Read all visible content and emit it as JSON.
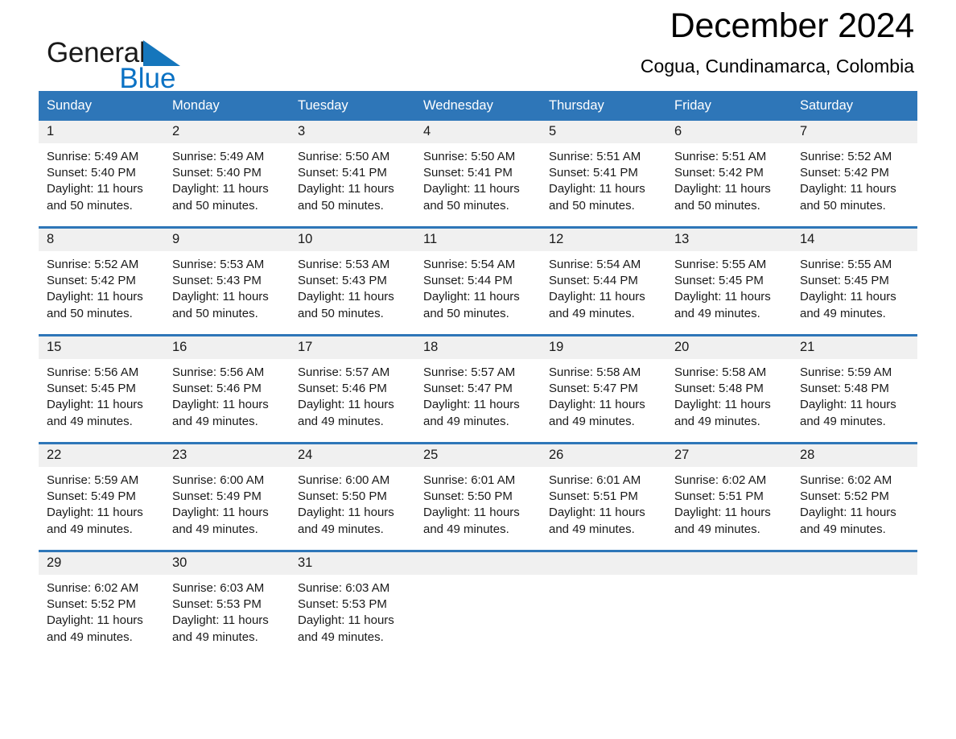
{
  "brand": {
    "name_part1": "General",
    "name_part2": "Blue",
    "triangle_color": "#1576bc",
    "logo_icon": "general-blue-triangle-logo"
  },
  "header": {
    "title": "December 2024",
    "subtitle": "Cogua, Cundinamarca, Colombia"
  },
  "theme": {
    "header_blue": "#2e76b8",
    "row_divider_blue": "#2e76b8",
    "daynum_band": "#f0f0f0",
    "text": "#1a1a1a",
    "page_background": "#ffffff"
  },
  "weekday_headers": [
    "Sunday",
    "Monday",
    "Tuesday",
    "Wednesday",
    "Thursday",
    "Friday",
    "Saturday"
  ],
  "weeks": [
    {
      "days": [
        {
          "date": "1",
          "sunrise": "Sunrise: 5:49 AM",
          "sunset": "Sunset: 5:40 PM",
          "daylight_line1": "Daylight: 11 hours",
          "daylight_line2": "and 50 minutes."
        },
        {
          "date": "2",
          "sunrise": "Sunrise: 5:49 AM",
          "sunset": "Sunset: 5:40 PM",
          "daylight_line1": "Daylight: 11 hours",
          "daylight_line2": "and 50 minutes."
        },
        {
          "date": "3",
          "sunrise": "Sunrise: 5:50 AM",
          "sunset": "Sunset: 5:41 PM",
          "daylight_line1": "Daylight: 11 hours",
          "daylight_line2": "and 50 minutes."
        },
        {
          "date": "4",
          "sunrise": "Sunrise: 5:50 AM",
          "sunset": "Sunset: 5:41 PM",
          "daylight_line1": "Daylight: 11 hours",
          "daylight_line2": "and 50 minutes."
        },
        {
          "date": "5",
          "sunrise": "Sunrise: 5:51 AM",
          "sunset": "Sunset: 5:41 PM",
          "daylight_line1": "Daylight: 11 hours",
          "daylight_line2": "and 50 minutes."
        },
        {
          "date": "6",
          "sunrise": "Sunrise: 5:51 AM",
          "sunset": "Sunset: 5:42 PM",
          "daylight_line1": "Daylight: 11 hours",
          "daylight_line2": "and 50 minutes."
        },
        {
          "date": "7",
          "sunrise": "Sunrise: 5:52 AM",
          "sunset": "Sunset: 5:42 PM",
          "daylight_line1": "Daylight: 11 hours",
          "daylight_line2": "and 50 minutes."
        }
      ]
    },
    {
      "days": [
        {
          "date": "8",
          "sunrise": "Sunrise: 5:52 AM",
          "sunset": "Sunset: 5:42 PM",
          "daylight_line1": "Daylight: 11 hours",
          "daylight_line2": "and 50 minutes."
        },
        {
          "date": "9",
          "sunrise": "Sunrise: 5:53 AM",
          "sunset": "Sunset: 5:43 PM",
          "daylight_line1": "Daylight: 11 hours",
          "daylight_line2": "and 50 minutes."
        },
        {
          "date": "10",
          "sunrise": "Sunrise: 5:53 AM",
          "sunset": "Sunset: 5:43 PM",
          "daylight_line1": "Daylight: 11 hours",
          "daylight_line2": "and 50 minutes."
        },
        {
          "date": "11",
          "sunrise": "Sunrise: 5:54 AM",
          "sunset": "Sunset: 5:44 PM",
          "daylight_line1": "Daylight: 11 hours",
          "daylight_line2": "and 50 minutes."
        },
        {
          "date": "12",
          "sunrise": "Sunrise: 5:54 AM",
          "sunset": "Sunset: 5:44 PM",
          "daylight_line1": "Daylight: 11 hours",
          "daylight_line2": "and 49 minutes."
        },
        {
          "date": "13",
          "sunrise": "Sunrise: 5:55 AM",
          "sunset": "Sunset: 5:45 PM",
          "daylight_line1": "Daylight: 11 hours",
          "daylight_line2": "and 49 minutes."
        },
        {
          "date": "14",
          "sunrise": "Sunrise: 5:55 AM",
          "sunset": "Sunset: 5:45 PM",
          "daylight_line1": "Daylight: 11 hours",
          "daylight_line2": "and 49 minutes."
        }
      ]
    },
    {
      "days": [
        {
          "date": "15",
          "sunrise": "Sunrise: 5:56 AM",
          "sunset": "Sunset: 5:45 PM",
          "daylight_line1": "Daylight: 11 hours",
          "daylight_line2": "and 49 minutes."
        },
        {
          "date": "16",
          "sunrise": "Sunrise: 5:56 AM",
          "sunset": "Sunset: 5:46 PM",
          "daylight_line1": "Daylight: 11 hours",
          "daylight_line2": "and 49 minutes."
        },
        {
          "date": "17",
          "sunrise": "Sunrise: 5:57 AM",
          "sunset": "Sunset: 5:46 PM",
          "daylight_line1": "Daylight: 11 hours",
          "daylight_line2": "and 49 minutes."
        },
        {
          "date": "18",
          "sunrise": "Sunrise: 5:57 AM",
          "sunset": "Sunset: 5:47 PM",
          "daylight_line1": "Daylight: 11 hours",
          "daylight_line2": "and 49 minutes."
        },
        {
          "date": "19",
          "sunrise": "Sunrise: 5:58 AM",
          "sunset": "Sunset: 5:47 PM",
          "daylight_line1": "Daylight: 11 hours",
          "daylight_line2": "and 49 minutes."
        },
        {
          "date": "20",
          "sunrise": "Sunrise: 5:58 AM",
          "sunset": "Sunset: 5:48 PM",
          "daylight_line1": "Daylight: 11 hours",
          "daylight_line2": "and 49 minutes."
        },
        {
          "date": "21",
          "sunrise": "Sunrise: 5:59 AM",
          "sunset": "Sunset: 5:48 PM",
          "daylight_line1": "Daylight: 11 hours",
          "daylight_line2": "and 49 minutes."
        }
      ]
    },
    {
      "days": [
        {
          "date": "22",
          "sunrise": "Sunrise: 5:59 AM",
          "sunset": "Sunset: 5:49 PM",
          "daylight_line1": "Daylight: 11 hours",
          "daylight_line2": "and 49 minutes."
        },
        {
          "date": "23",
          "sunrise": "Sunrise: 6:00 AM",
          "sunset": "Sunset: 5:49 PM",
          "daylight_line1": "Daylight: 11 hours",
          "daylight_line2": "and 49 minutes."
        },
        {
          "date": "24",
          "sunrise": "Sunrise: 6:00 AM",
          "sunset": "Sunset: 5:50 PM",
          "daylight_line1": "Daylight: 11 hours",
          "daylight_line2": "and 49 minutes."
        },
        {
          "date": "25",
          "sunrise": "Sunrise: 6:01 AM",
          "sunset": "Sunset: 5:50 PM",
          "daylight_line1": "Daylight: 11 hours",
          "daylight_line2": "and 49 minutes."
        },
        {
          "date": "26",
          "sunrise": "Sunrise: 6:01 AM",
          "sunset": "Sunset: 5:51 PM",
          "daylight_line1": "Daylight: 11 hours",
          "daylight_line2": "and 49 minutes."
        },
        {
          "date": "27",
          "sunrise": "Sunrise: 6:02 AM",
          "sunset": "Sunset: 5:51 PM",
          "daylight_line1": "Daylight: 11 hours",
          "daylight_line2": "and 49 minutes."
        },
        {
          "date": "28",
          "sunrise": "Sunrise: 6:02 AM",
          "sunset": "Sunset: 5:52 PM",
          "daylight_line1": "Daylight: 11 hours",
          "daylight_line2": "and 49 minutes."
        }
      ]
    },
    {
      "days": [
        {
          "date": "29",
          "sunrise": "Sunrise: 6:02 AM",
          "sunset": "Sunset: 5:52 PM",
          "daylight_line1": "Daylight: 11 hours",
          "daylight_line2": "and 49 minutes."
        },
        {
          "date": "30",
          "sunrise": "Sunrise: 6:03 AM",
          "sunset": "Sunset: 5:53 PM",
          "daylight_line1": "Daylight: 11 hours",
          "daylight_line2": "and 49 minutes."
        },
        {
          "date": "31",
          "sunrise": "Sunrise: 6:03 AM",
          "sunset": "Sunset: 5:53 PM",
          "daylight_line1": "Daylight: 11 hours",
          "daylight_line2": "and 49 minutes."
        },
        {
          "date": "",
          "sunrise": "",
          "sunset": "",
          "daylight_line1": "",
          "daylight_line2": ""
        },
        {
          "date": "",
          "sunrise": "",
          "sunset": "",
          "daylight_line1": "",
          "daylight_line2": ""
        },
        {
          "date": "",
          "sunrise": "",
          "sunset": "",
          "daylight_line1": "",
          "daylight_line2": ""
        },
        {
          "date": "",
          "sunrise": "",
          "sunset": "",
          "daylight_line1": "",
          "daylight_line2": ""
        }
      ]
    }
  ]
}
